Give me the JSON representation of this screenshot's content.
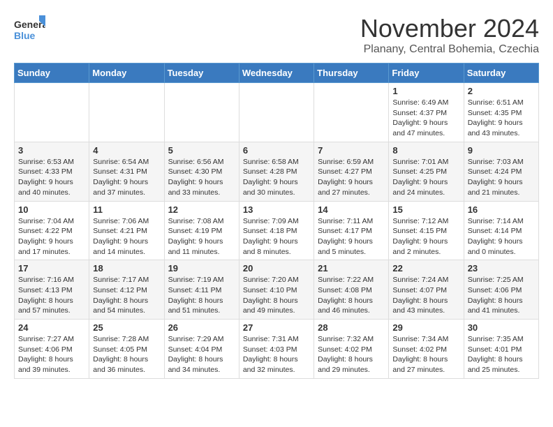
{
  "header": {
    "logo_general": "General",
    "logo_blue": "Blue",
    "month_title": "November 2024",
    "location": "Planany, Central Bohemia, Czechia"
  },
  "weekdays": [
    "Sunday",
    "Monday",
    "Tuesday",
    "Wednesday",
    "Thursday",
    "Friday",
    "Saturday"
  ],
  "weeks": [
    [
      {
        "day": "",
        "info": ""
      },
      {
        "day": "",
        "info": ""
      },
      {
        "day": "",
        "info": ""
      },
      {
        "day": "",
        "info": ""
      },
      {
        "day": "",
        "info": ""
      },
      {
        "day": "1",
        "info": "Sunrise: 6:49 AM\nSunset: 4:37 PM\nDaylight: 9 hours\nand 47 minutes."
      },
      {
        "day": "2",
        "info": "Sunrise: 6:51 AM\nSunset: 4:35 PM\nDaylight: 9 hours\nand 43 minutes."
      }
    ],
    [
      {
        "day": "3",
        "info": "Sunrise: 6:53 AM\nSunset: 4:33 PM\nDaylight: 9 hours\nand 40 minutes."
      },
      {
        "day": "4",
        "info": "Sunrise: 6:54 AM\nSunset: 4:31 PM\nDaylight: 9 hours\nand 37 minutes."
      },
      {
        "day": "5",
        "info": "Sunrise: 6:56 AM\nSunset: 4:30 PM\nDaylight: 9 hours\nand 33 minutes."
      },
      {
        "day": "6",
        "info": "Sunrise: 6:58 AM\nSunset: 4:28 PM\nDaylight: 9 hours\nand 30 minutes."
      },
      {
        "day": "7",
        "info": "Sunrise: 6:59 AM\nSunset: 4:27 PM\nDaylight: 9 hours\nand 27 minutes."
      },
      {
        "day": "8",
        "info": "Sunrise: 7:01 AM\nSunset: 4:25 PM\nDaylight: 9 hours\nand 24 minutes."
      },
      {
        "day": "9",
        "info": "Sunrise: 7:03 AM\nSunset: 4:24 PM\nDaylight: 9 hours\nand 21 minutes."
      }
    ],
    [
      {
        "day": "10",
        "info": "Sunrise: 7:04 AM\nSunset: 4:22 PM\nDaylight: 9 hours\nand 17 minutes."
      },
      {
        "day": "11",
        "info": "Sunrise: 7:06 AM\nSunset: 4:21 PM\nDaylight: 9 hours\nand 14 minutes."
      },
      {
        "day": "12",
        "info": "Sunrise: 7:08 AM\nSunset: 4:19 PM\nDaylight: 9 hours\nand 11 minutes."
      },
      {
        "day": "13",
        "info": "Sunrise: 7:09 AM\nSunset: 4:18 PM\nDaylight: 9 hours\nand 8 minutes."
      },
      {
        "day": "14",
        "info": "Sunrise: 7:11 AM\nSunset: 4:17 PM\nDaylight: 9 hours\nand 5 minutes."
      },
      {
        "day": "15",
        "info": "Sunrise: 7:12 AM\nSunset: 4:15 PM\nDaylight: 9 hours\nand 2 minutes."
      },
      {
        "day": "16",
        "info": "Sunrise: 7:14 AM\nSunset: 4:14 PM\nDaylight: 9 hours\nand 0 minutes."
      }
    ],
    [
      {
        "day": "17",
        "info": "Sunrise: 7:16 AM\nSunset: 4:13 PM\nDaylight: 8 hours\nand 57 minutes."
      },
      {
        "day": "18",
        "info": "Sunrise: 7:17 AM\nSunset: 4:12 PM\nDaylight: 8 hours\nand 54 minutes."
      },
      {
        "day": "19",
        "info": "Sunrise: 7:19 AM\nSunset: 4:11 PM\nDaylight: 8 hours\nand 51 minutes."
      },
      {
        "day": "20",
        "info": "Sunrise: 7:20 AM\nSunset: 4:10 PM\nDaylight: 8 hours\nand 49 minutes."
      },
      {
        "day": "21",
        "info": "Sunrise: 7:22 AM\nSunset: 4:08 PM\nDaylight: 8 hours\nand 46 minutes."
      },
      {
        "day": "22",
        "info": "Sunrise: 7:24 AM\nSunset: 4:07 PM\nDaylight: 8 hours\nand 43 minutes."
      },
      {
        "day": "23",
        "info": "Sunrise: 7:25 AM\nSunset: 4:06 PM\nDaylight: 8 hours\nand 41 minutes."
      }
    ],
    [
      {
        "day": "24",
        "info": "Sunrise: 7:27 AM\nSunset: 4:06 PM\nDaylight: 8 hours\nand 39 minutes."
      },
      {
        "day": "25",
        "info": "Sunrise: 7:28 AM\nSunset: 4:05 PM\nDaylight: 8 hours\nand 36 minutes."
      },
      {
        "day": "26",
        "info": "Sunrise: 7:29 AM\nSunset: 4:04 PM\nDaylight: 8 hours\nand 34 minutes."
      },
      {
        "day": "27",
        "info": "Sunrise: 7:31 AM\nSunset: 4:03 PM\nDaylight: 8 hours\nand 32 minutes."
      },
      {
        "day": "28",
        "info": "Sunrise: 7:32 AM\nSunset: 4:02 PM\nDaylight: 8 hours\nand 29 minutes."
      },
      {
        "day": "29",
        "info": "Sunrise: 7:34 AM\nSunset: 4:02 PM\nDaylight: 8 hours\nand 27 minutes."
      },
      {
        "day": "30",
        "info": "Sunrise: 7:35 AM\nSunset: 4:01 PM\nDaylight: 8 hours\nand 25 minutes."
      }
    ]
  ]
}
